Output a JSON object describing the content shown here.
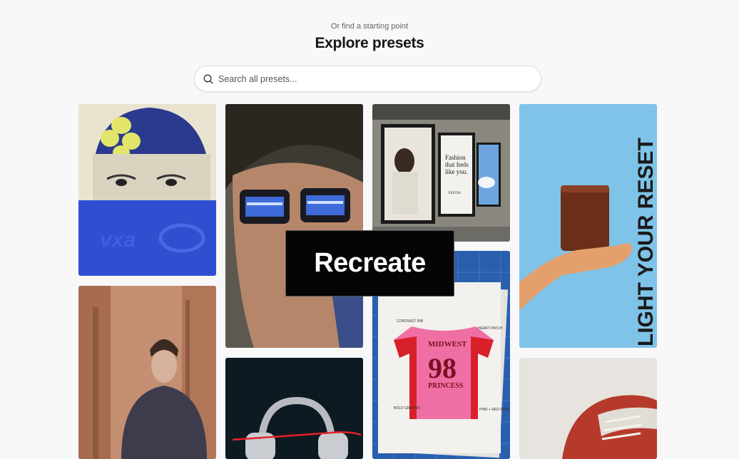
{
  "header": {
    "subtitle": "Or find a starting point",
    "title": "Explore presets"
  },
  "search": {
    "placeholder": "Search all presets...",
    "icon": "search-icon"
  },
  "presets": [
    {
      "id": "beanie-portrait",
      "icon": "image"
    },
    {
      "id": "glasses-portrait",
      "icon": "image"
    },
    {
      "id": "subway-posters",
      "icon": "image",
      "poster_text": [
        "Fashion",
        "that feels",
        "like you.",
        "VESTIA"
      ]
    },
    {
      "id": "candle-ad",
      "icon": "image",
      "headline": "LIGHT YOUR RESET"
    },
    {
      "id": "hoodie-portrait",
      "icon": "image"
    },
    {
      "id": "jersey-sketch",
      "icon": "image",
      "jersey_text": [
        "MIDWEST",
        "98",
        "PRINCESS"
      ],
      "notes": [
        "CONTRAST RIB",
        "HEART PATCH",
        "BOLD GRAPHIC",
        "PINK + RED PANEL"
      ]
    },
    {
      "id": "headphones",
      "icon": "image"
    },
    {
      "id": "sneaker",
      "icon": "image"
    }
  ],
  "overlay": {
    "label": "Recreate"
  },
  "colors": {
    "background": "#f8f8f8",
    "overlay": "#050505"
  }
}
